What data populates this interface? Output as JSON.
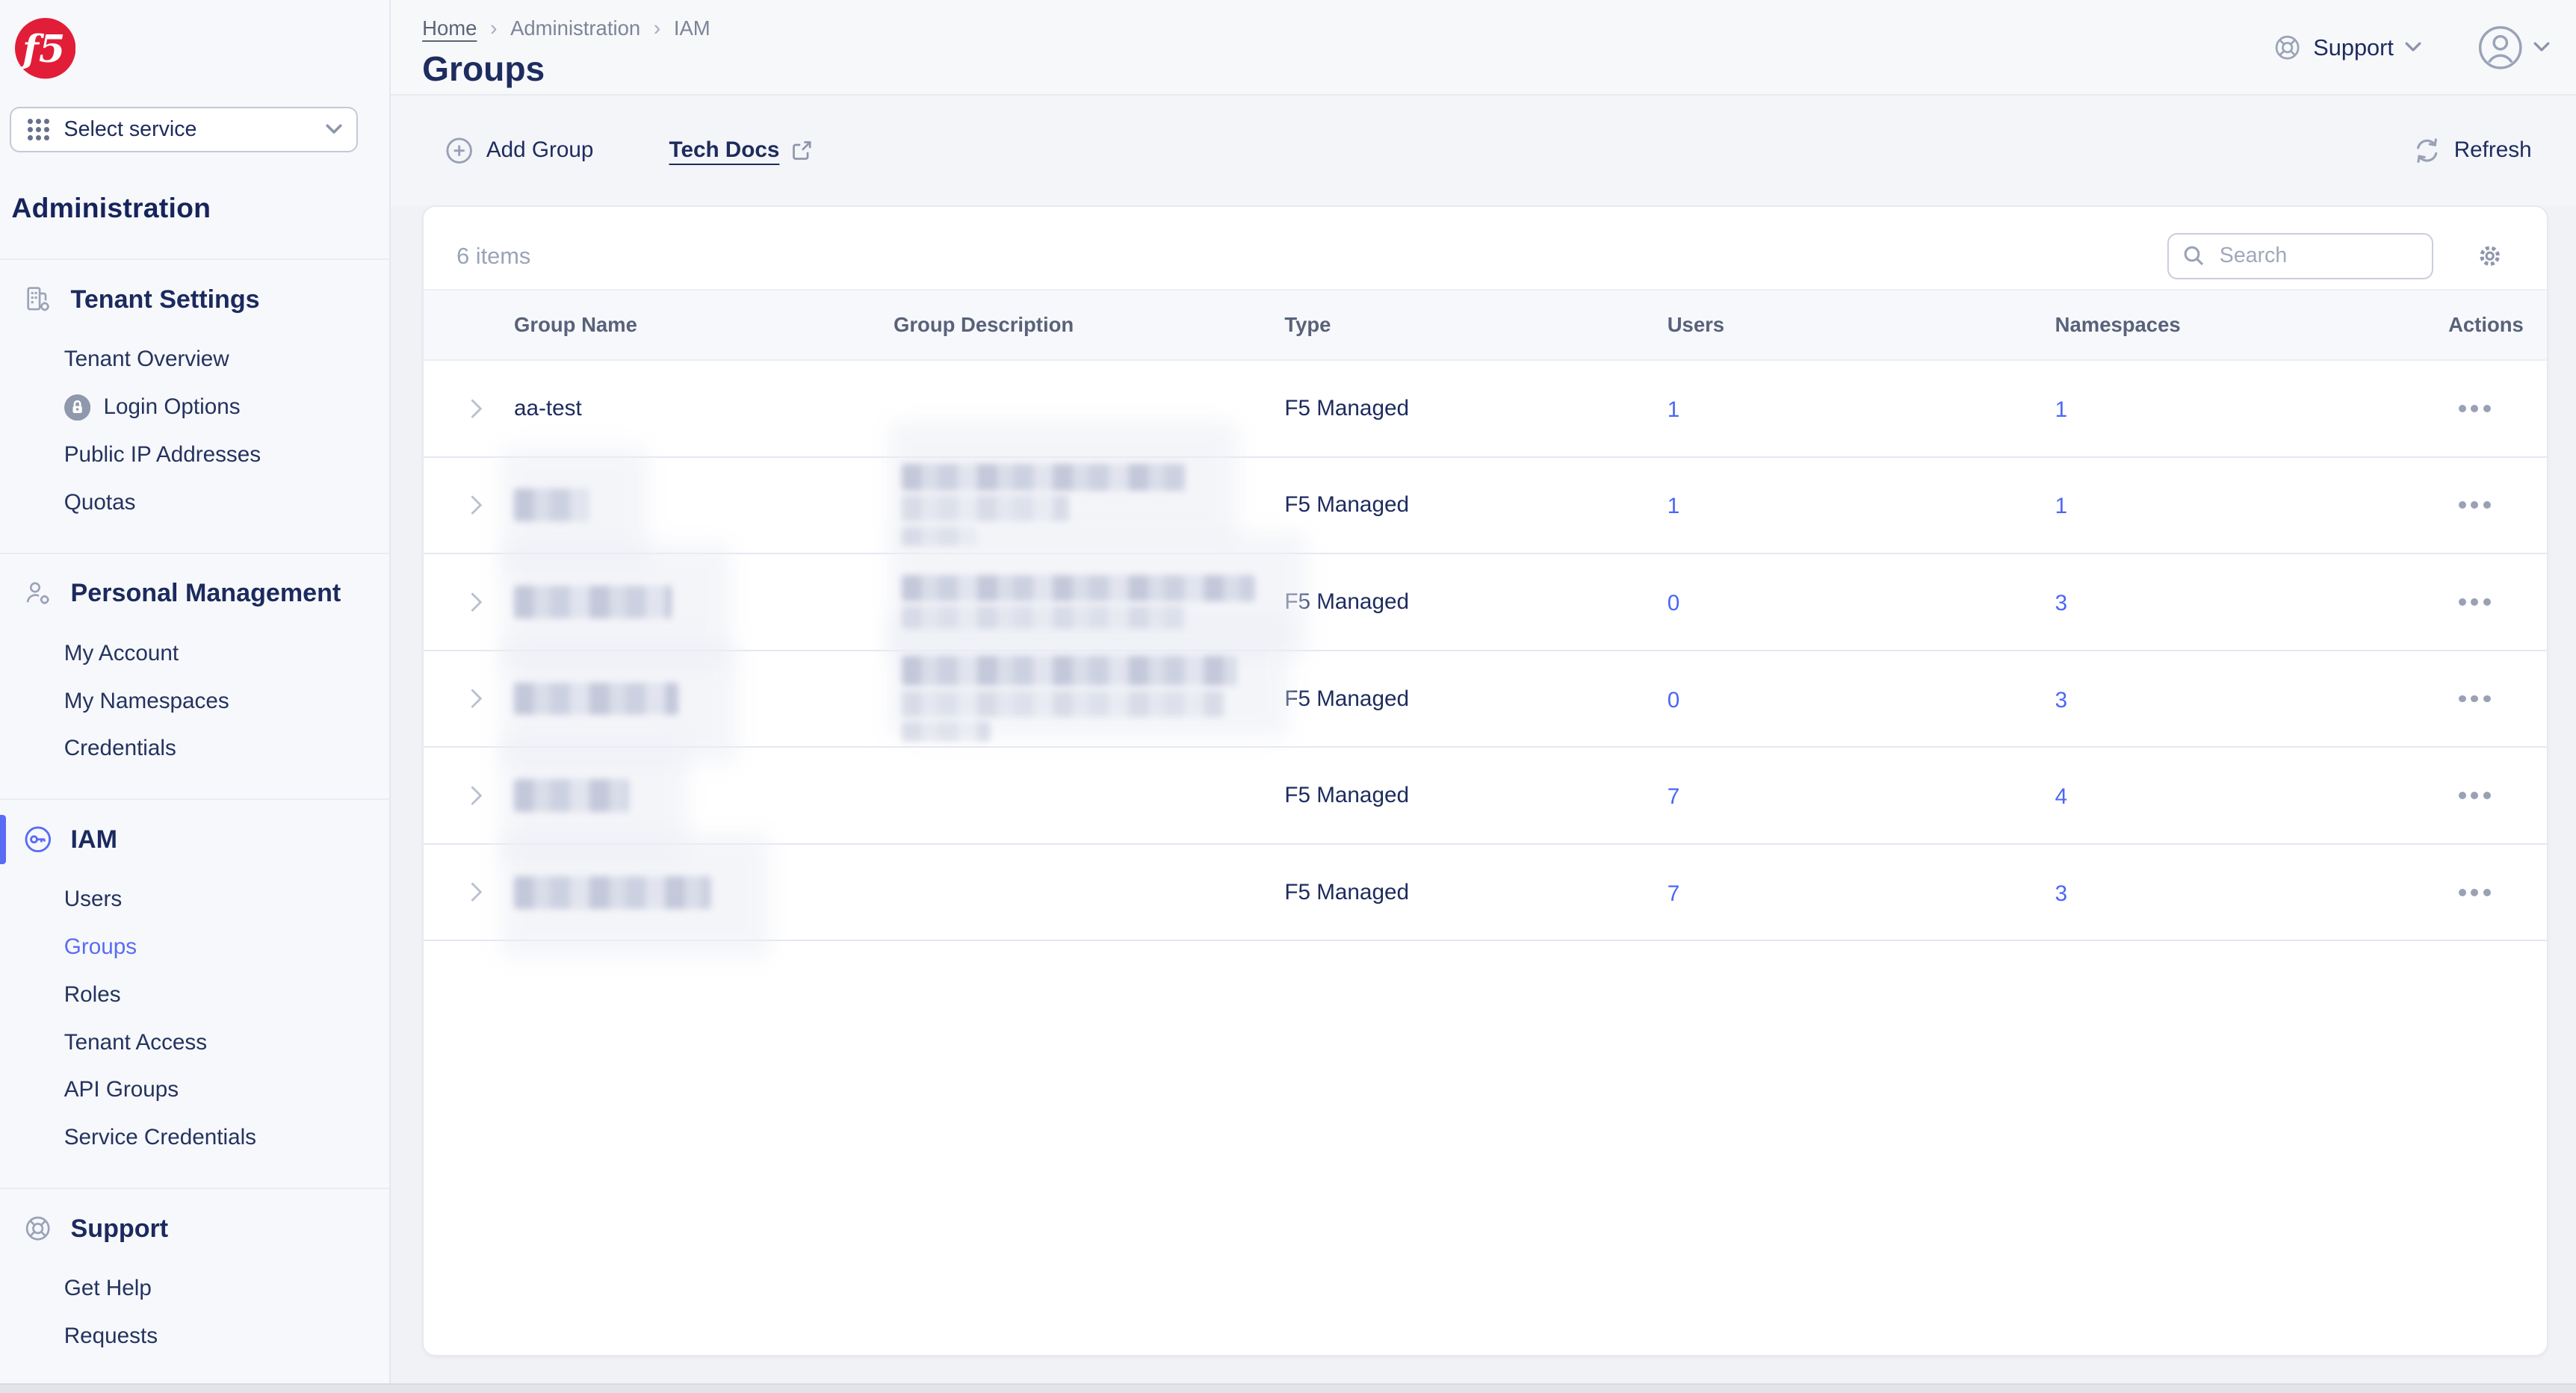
{
  "brand": {
    "logo_text": "f5",
    "logo_color": "#e21d38"
  },
  "sidebar": {
    "select_service_label": "Select service",
    "product_title": "Administration",
    "sections": [
      {
        "id": "tenant-settings",
        "label": "Tenant Settings",
        "icon": "tenant-settings-icon",
        "active": false,
        "items": [
          {
            "label": "Tenant Overview",
            "active": false
          },
          {
            "label": "Login Options",
            "active": false,
            "badge": "lock-badge-icon"
          },
          {
            "label": "Public IP Addresses",
            "active": false
          },
          {
            "label": "Quotas",
            "active": false
          }
        ]
      },
      {
        "id": "personal-management",
        "label": "Personal Management",
        "icon": "personal-management-icon",
        "active": false,
        "items": [
          {
            "label": "My Account",
            "active": false
          },
          {
            "label": "My Namespaces",
            "active": false
          },
          {
            "label": "Credentials",
            "active": false
          }
        ]
      },
      {
        "id": "iam",
        "label": "IAM",
        "icon": "iam-key-icon",
        "active": true,
        "items": [
          {
            "label": "Users",
            "active": false
          },
          {
            "label": "Groups",
            "active": true
          },
          {
            "label": "Roles",
            "active": false
          },
          {
            "label": "Tenant Access",
            "active": false
          },
          {
            "label": "API Groups",
            "active": false
          },
          {
            "label": "Service Credentials",
            "active": false
          }
        ]
      },
      {
        "id": "support",
        "label": "Support",
        "icon": "lifebuoy-icon",
        "active": false,
        "items": [
          {
            "label": "Get Help",
            "active": false
          },
          {
            "label": "Requests",
            "active": false
          }
        ]
      }
    ]
  },
  "header": {
    "breadcrumb": [
      "Home",
      "Administration",
      "IAM"
    ],
    "separator": "›",
    "page_title": "Groups",
    "support_label": "Support"
  },
  "toolbar": {
    "add_group_label": "Add Group",
    "tech_docs_label": "Tech Docs",
    "refresh_label": "Refresh"
  },
  "table": {
    "items_count": "6 items",
    "search_placeholder": "Search",
    "columns": [
      "Group Name",
      "Group Description",
      "Type",
      "Users",
      "Namespaces",
      "Actions"
    ],
    "rows": [
      {
        "name": "aa-test",
        "redacted_name": false,
        "redacted_desc": false,
        "type": "F5 Managed",
        "users": "1",
        "namespaces": "1"
      },
      {
        "name": "",
        "redacted_name": true,
        "name_w": 46,
        "redacted_desc": true,
        "desc_lines": [
          [
            173,
            16
          ],
          [
            102,
            16
          ],
          [
            46,
            12
          ]
        ],
        "type": "F5 Managed",
        "users": "1",
        "namespaces": "1"
      },
      {
        "name": "",
        "redacted_name": true,
        "name_w": 96,
        "redacted_desc": true,
        "desc_lines": [
          [
            215,
            16
          ],
          [
            172,
            14
          ]
        ],
        "type": "F5 Managed",
        "users": "0",
        "namespaces": "3"
      },
      {
        "name": "",
        "redacted_name": true,
        "name_w": 100,
        "redacted_desc": true,
        "desc_lines": [
          [
            204,
            18
          ],
          [
            196,
            16
          ],
          [
            54,
            12
          ]
        ],
        "type": "F5 Managed",
        "users": "0",
        "namespaces": "3"
      },
      {
        "name": "",
        "redacted_name": true,
        "name_w": 70,
        "redacted_desc": false,
        "type": "F5 Managed",
        "users": "7",
        "namespaces": "4"
      },
      {
        "name": "",
        "redacted_name": true,
        "name_w": 120,
        "redacted_desc": false,
        "type": "F5 Managed",
        "users": "7",
        "namespaces": "3"
      }
    ]
  },
  "icons": [
    "f5-logo",
    "grid-icon",
    "chevron-down-icon",
    "tenant-settings-icon",
    "personal-management-icon",
    "iam-key-icon",
    "lifebuoy-icon",
    "lock-badge-icon",
    "plus-circle-icon",
    "external-link-icon",
    "refresh-icon",
    "search-icon",
    "gear-icon",
    "avatar-icon",
    "chevron-right-icon",
    "ellipsis-icon",
    "breadcrumb-separator"
  ],
  "colors": {
    "brand_red": "#e21d38",
    "link_blue": "#4a67f5",
    "active_blue": "#5a6cf3",
    "navy": "#1d2b5e"
  }
}
